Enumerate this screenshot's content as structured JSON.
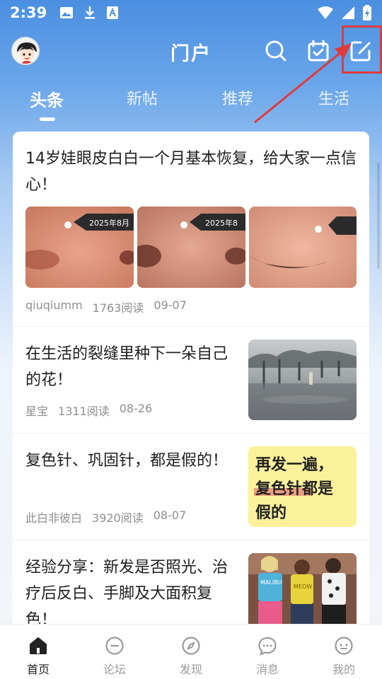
{
  "status_bar": {
    "time": "2:39"
  },
  "header": {
    "title": "门户"
  },
  "tabs": [
    {
      "label": "头条",
      "active": true
    },
    {
      "label": "新帖",
      "active": false
    },
    {
      "label": "推荐",
      "active": false
    },
    {
      "label": "生活",
      "active": false
    }
  ],
  "posts": [
    {
      "title": "14岁娃眼皮白白一个月基本恢复，给大家一点信心！",
      "author": "qiuqiumm",
      "reads": "1763阅读",
      "date": "09-07",
      "images": [
        {
          "watermark": "2025年8月"
        },
        {
          "watermark": "2025年8"
        },
        {
          "watermark": ""
        }
      ]
    },
    {
      "title": "在生活的裂缝里种下一朵自己的花！",
      "author": "星宝",
      "reads": "1311阅读",
      "date": "08-26"
    },
    {
      "title": "复色针、巩固针，都是假的！",
      "author": "此白非彼白",
      "reads": "3920阅读",
      "date": "08-07",
      "thumb_text": {
        "line1": "再发一遍，",
        "line2": "复色针都是",
        "line3": "假的"
      }
    },
    {
      "title": "经验分享：新发是否照光、治疗后反白、手脚及大面积复色！",
      "thumb_text": {
        "shirt1": "MALIBU",
        "shirt2": "MEOW"
      }
    }
  ],
  "bottom_nav": [
    {
      "label": "首页",
      "icon": "home-icon",
      "active": true
    },
    {
      "label": "论坛",
      "icon": "forum-icon",
      "active": false
    },
    {
      "label": "发现",
      "icon": "compass-icon",
      "active": false
    },
    {
      "label": "消息",
      "icon": "message-icon",
      "active": false
    },
    {
      "label": "我的",
      "icon": "profile-icon",
      "active": false
    }
  ],
  "colors": {
    "accent": "#4a8fe0",
    "annotation": "#e03a3a"
  }
}
